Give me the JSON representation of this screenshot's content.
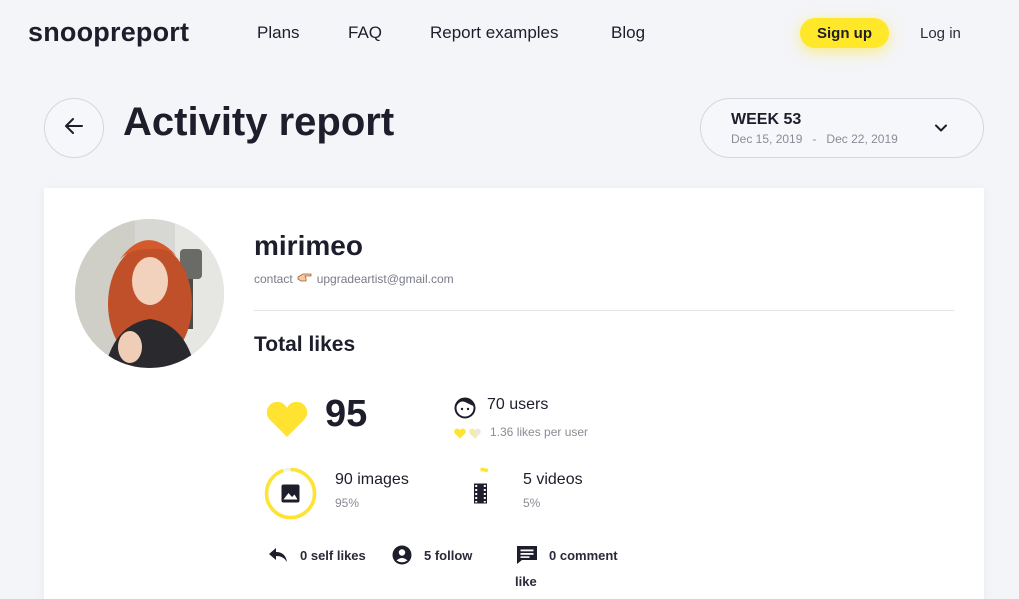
{
  "header": {
    "logo": "snoopreport",
    "nav": [
      "Plans",
      "FAQ",
      "Report examples",
      "Blog"
    ],
    "signup_label": "Sign up",
    "login_label": "Log in"
  },
  "title_row": {
    "page_title": "Activity report",
    "week_label": "WEEK 53",
    "week_start": "Dec 15, 2019",
    "week_sep": "-",
    "week_end": "Dec 22, 2019"
  },
  "profile": {
    "username": "mirimeo",
    "contact_prefix": "contact",
    "contact_email": "upgradeartist@gmail.com"
  },
  "total_likes": {
    "section_title": "Total likes",
    "likes": "95",
    "users": "70 users",
    "likes_per_user": "1.36 likes per user",
    "images": "90 images",
    "images_pct": "95%",
    "images_fraction": 0.95,
    "videos": "5 videos",
    "videos_pct": "5%",
    "videos_fraction": 0.05,
    "self_likes": "0 self likes",
    "follow_likes": "5 follow",
    "comment_likes_line1": "0 comment",
    "comment_likes_line2": "like"
  },
  "colors": {
    "accent": "#ffe82a",
    "heart": "#ffe330",
    "text_dark": "#1d1d2c",
    "text_muted": "#8a8c96",
    "background": "#f4f5f8"
  }
}
